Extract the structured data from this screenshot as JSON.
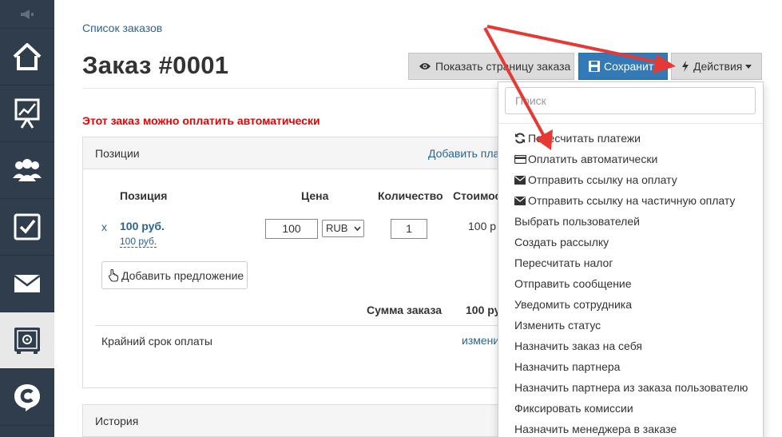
{
  "breadcrumb": "Список заказов",
  "title": "Заказ #0001",
  "toolbar": {
    "show_page": "Показать страницу заказа",
    "save": "Сохранить",
    "actions": "Действия"
  },
  "notice": "Этот заказ можно оплатить автоматически",
  "positions_panel": {
    "title": "Позиции",
    "add_payment": "Добавить плат",
    "headers": {
      "position": "Позиция",
      "price": "Цена",
      "quantity": "Количество",
      "cost": "Стоимос"
    },
    "row": {
      "remove": "x",
      "name": "100 руб.",
      "subname": "100 руб.",
      "price": "100",
      "currency": "RUB",
      "quantity": "1",
      "cost": "100 р"
    },
    "add_offer": "Добавить предложение",
    "sum_label": "Сумма заказа",
    "sum_value": "100 руб",
    "deadline_label": "Крайний срок оплаты",
    "change": "измени"
  },
  "history_panel": {
    "title": "История"
  },
  "dropdown": {
    "search_placeholder": "Поиск",
    "items": [
      {
        "label": "Пересчитать платежи",
        "icon": "refresh-icon"
      },
      {
        "label": "Оплатить автоматически",
        "icon": "credit-card-icon"
      },
      {
        "label": "Отправить ссылку на оплату",
        "icon": "envelope-icon"
      },
      {
        "label": "Отправить ссылку на частичную оплату",
        "icon": "envelope-icon"
      },
      {
        "label": "Выбрать пользователей",
        "icon": ""
      },
      {
        "label": "Создать рассылку",
        "icon": ""
      },
      {
        "label": "Пересчитать налог",
        "icon": ""
      },
      {
        "label": "Отправить сообщение",
        "icon": ""
      },
      {
        "label": "Уведомить сотрудника",
        "icon": ""
      },
      {
        "label": "Изменить статус",
        "icon": ""
      },
      {
        "label": "Назначить заказ на себя",
        "icon": ""
      },
      {
        "label": "Назначить партнера",
        "icon": ""
      },
      {
        "label": "Назначить партнера из заказа пользователю",
        "icon": ""
      },
      {
        "label": "Фиксировать комиссии",
        "icon": ""
      },
      {
        "label": "Назначить менеджера в заказе",
        "icon": ""
      }
    ]
  },
  "sidebar": {
    "items": [
      {
        "icon": "megaphone-icon"
      },
      {
        "icon": "home-icon"
      },
      {
        "icon": "chart-board-icon"
      },
      {
        "icon": "users-icon"
      },
      {
        "icon": "checkbox-icon"
      },
      {
        "icon": "mail-icon"
      },
      {
        "icon": "safe-icon"
      },
      {
        "icon": "chat-logo-icon"
      }
    ]
  },
  "colors": {
    "sidebar_bg": "#2f3d4c",
    "primary": "#337ab7",
    "link": "#2a6496",
    "alert": "#e00000",
    "arrow": "#e53935"
  }
}
